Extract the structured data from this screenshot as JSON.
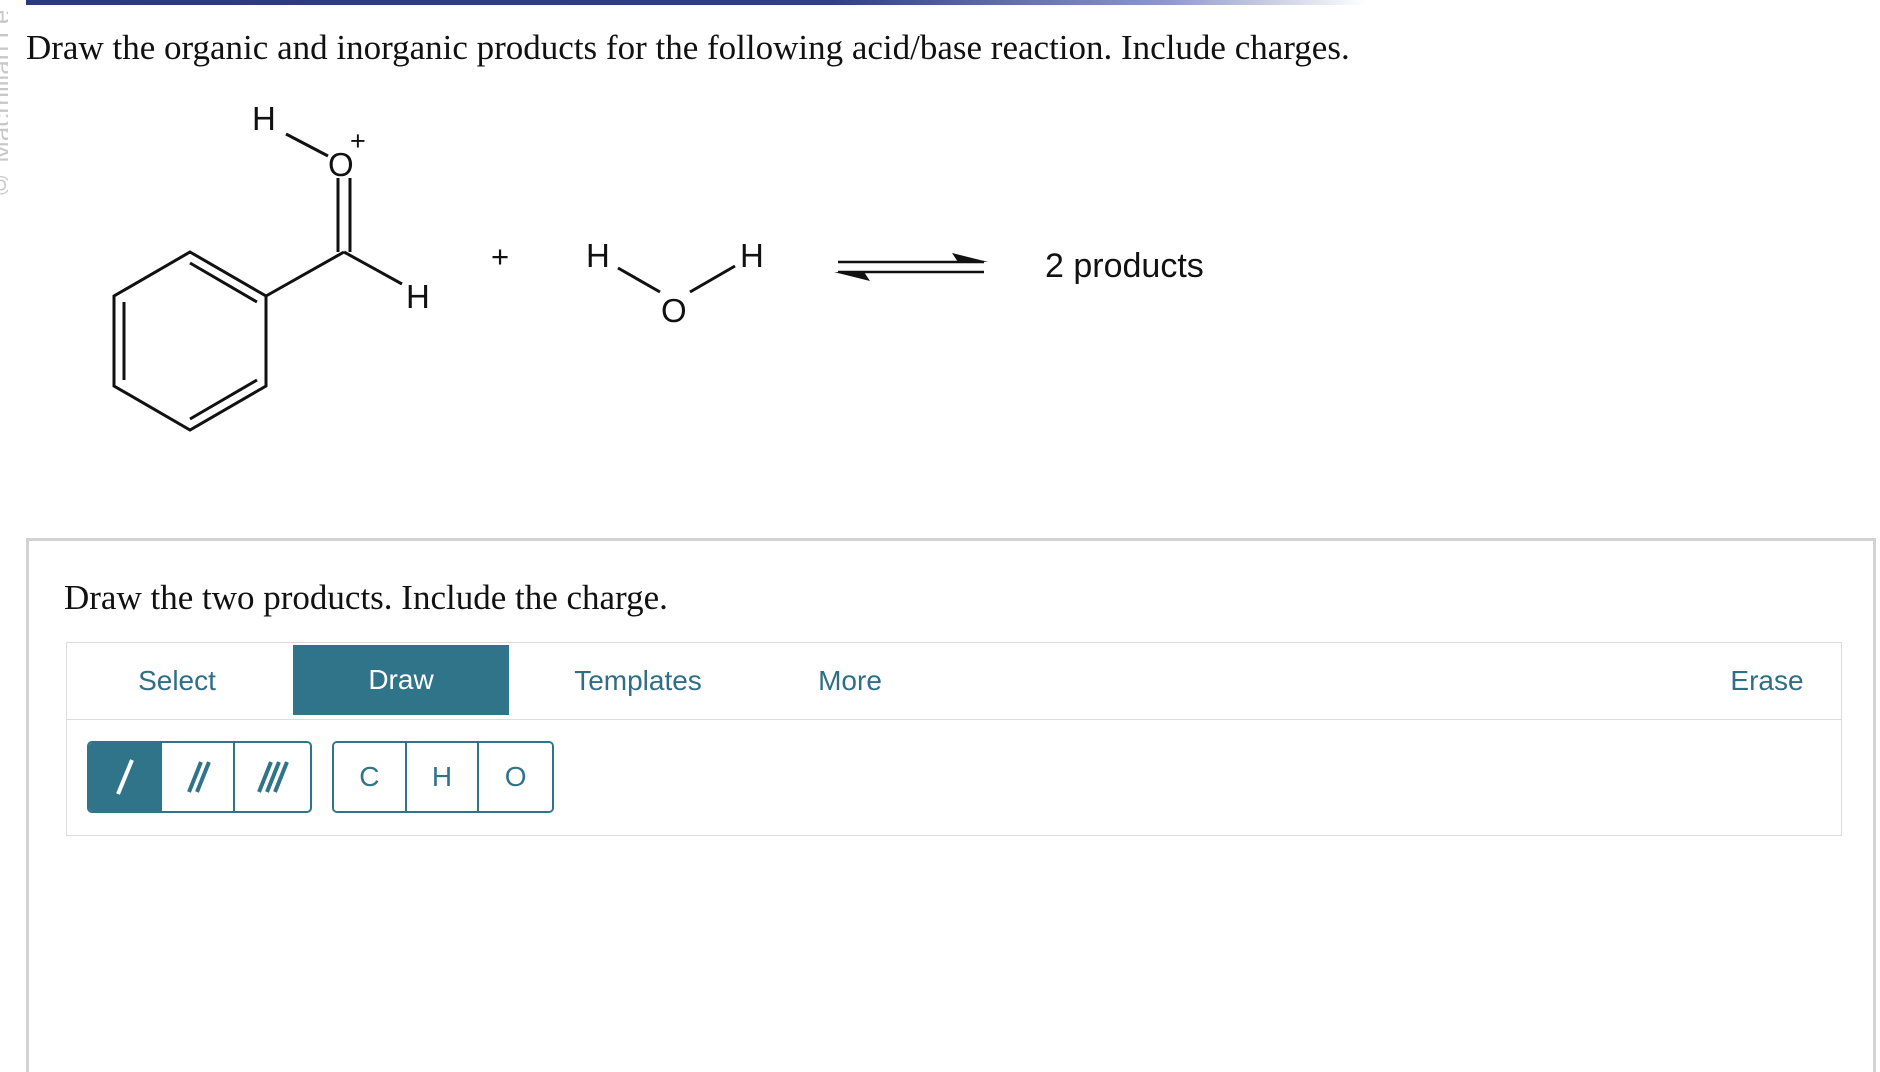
{
  "header": {
    "watermark": "© Macmillan Le",
    "question": "Draw the organic and inorganic products for the following acid/base reaction. Include charges."
  },
  "reaction": {
    "reactant1_atoms": {
      "h_top": "H",
      "o": "O",
      "charge": "+",
      "h_side": "H"
    },
    "plus": "+",
    "reactant2_atoms": {
      "h_left": "H",
      "o": "O",
      "h_right": "H"
    },
    "products_label": "2 products"
  },
  "panel": {
    "prompt": "Draw the two products. Include the charge.",
    "tabs": [
      {
        "label": "Select",
        "active": false
      },
      {
        "label": "Draw",
        "active": true
      },
      {
        "label": "Templates",
        "active": false
      },
      {
        "label": "More",
        "active": false
      },
      {
        "label": "Erase",
        "active": false
      }
    ],
    "atom_buttons": [
      "C",
      "H",
      "O"
    ]
  },
  "colors": {
    "accent": "#30748a",
    "topbar": "#2a3a7c",
    "panel_border": "#d3d3d3"
  }
}
